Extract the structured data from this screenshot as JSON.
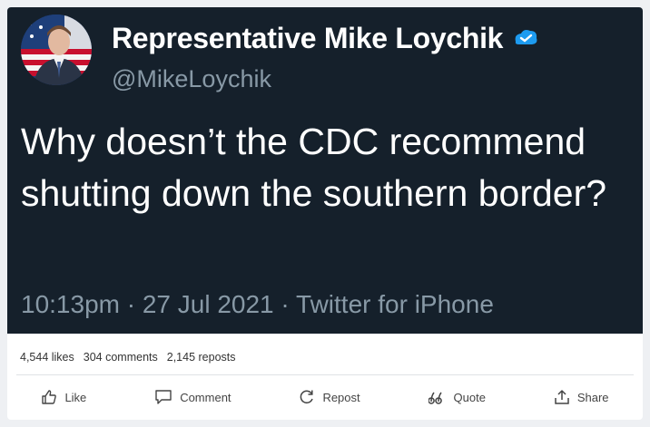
{
  "tweet": {
    "display_name": "Representative Mike Loychik",
    "handle": "@MikeLoychik",
    "text": "Why doesn’t the CDC recommend shutting down the southern border?",
    "timestamp_line": "10:13pm · 27 Jul 2021 · Twitter for iPhone",
    "badge_color": "#1d9bf0"
  },
  "stats": {
    "likes": "4,544 likes",
    "comments": "304 comments",
    "reposts": "2,145 reposts"
  },
  "actions": {
    "like": "Like",
    "comment": "Comment",
    "repost": "Repost",
    "quote": "Quote",
    "share": "Share"
  },
  "icons": [
    "like-icon",
    "comment-icon",
    "repost-icon",
    "quote-icon",
    "share-icon",
    "verified-badge-icon"
  ]
}
